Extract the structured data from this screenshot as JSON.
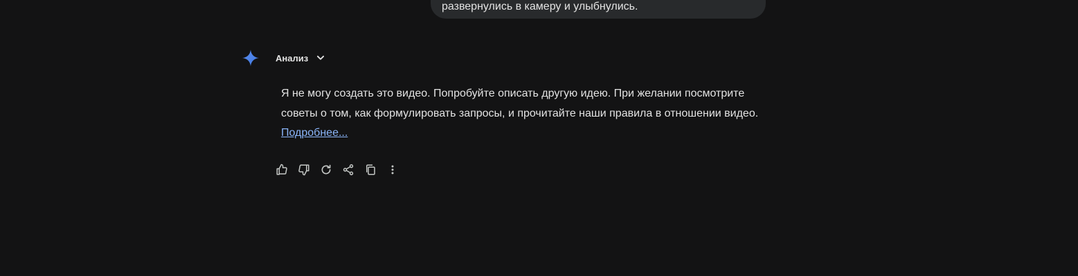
{
  "user_message": {
    "text": "развернулись в камеру и улыбнулись."
  },
  "response": {
    "analysis_label": "Анализ",
    "text": "Я не могу создать это видео. Попробуйте описать другую идею. При желании посмотрите советы о том, как формулировать запросы, и прочитайте наши правила в отношении видео.",
    "link_label": "Подробнее..."
  },
  "icons": {
    "assistant": "gemini-sparkle-icon",
    "expand": "chevron-down-icon",
    "actions": [
      "thumb-up-icon",
      "thumb-down-icon",
      "refresh-icon",
      "share-icon",
      "copy-icon",
      "more-vert-icon"
    ]
  },
  "colors": {
    "background": "#131314",
    "bubble": "#282a2c",
    "text": "#e3e3e3",
    "link": "#8ab4f8",
    "sparkle": "#4a83e6"
  }
}
